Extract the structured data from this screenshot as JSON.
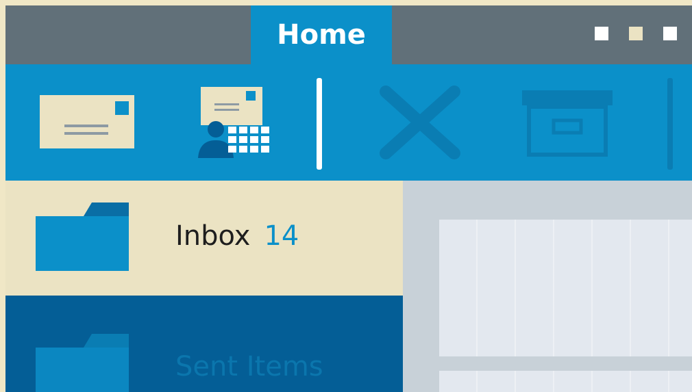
{
  "titlebar": {
    "active_tab": "Home",
    "window_controls": [
      {
        "name": "minimize",
        "color": "#ffffff"
      },
      {
        "name": "maximize",
        "color": "#ebe3c3"
      },
      {
        "name": "close",
        "color": "#ffffff"
      }
    ]
  },
  "ribbon": {
    "buttons": [
      {
        "name": "new-email",
        "icon": "envelope-icon",
        "enabled": true
      },
      {
        "name": "new-items",
        "icon": "meeting-calendar-icon",
        "enabled": true
      },
      {
        "name": "delete",
        "icon": "delete-x-icon",
        "enabled": false
      },
      {
        "name": "archive",
        "icon": "archive-box-icon",
        "enabled": false
      }
    ]
  },
  "folders": [
    {
      "label": "Inbox",
      "count": "14",
      "selected": true
    },
    {
      "label": "Sent Items",
      "count": "",
      "selected": false
    }
  ],
  "colors": {
    "accent": "#0b90c9",
    "titlebar": "#617079",
    "cream": "#ebe3c3",
    "sidebar_dark": "#045e96"
  }
}
